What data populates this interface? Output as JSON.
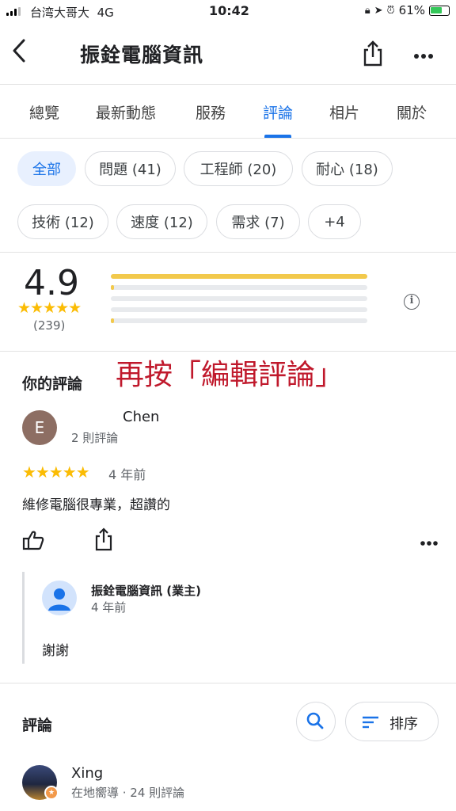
{
  "status_bar": {
    "carrier": "台湾大哥大",
    "network": "4G",
    "time": "10:42",
    "battery": "61%",
    "battery_level": 0.61
  },
  "header": {
    "title": "振銓電腦資訊"
  },
  "tabs": [
    {
      "label": "總覽",
      "active": false
    },
    {
      "label": "最新動態",
      "active": false
    },
    {
      "label": "服務",
      "active": false
    },
    {
      "label": "評論",
      "active": true
    },
    {
      "label": "相片",
      "active": false
    },
    {
      "label": "關於",
      "active": false
    }
  ],
  "filters": [
    {
      "label": "全部",
      "selected": true
    },
    {
      "label": "問題 (41)",
      "selected": false
    },
    {
      "label": "工程師 (20)",
      "selected": false
    },
    {
      "label": "耐心 (18)",
      "selected": false
    },
    {
      "label": "技術 (12)",
      "selected": false
    },
    {
      "label": "速度 (12)",
      "selected": false
    },
    {
      "label": "需求 (7)",
      "selected": false
    },
    {
      "label": "+4",
      "selected": false
    }
  ],
  "rating": {
    "average": "4.9",
    "stars": "★★★★★",
    "count": "(239)",
    "distribution": [
      1.0,
      0.01,
      0.0,
      0.0,
      0.01
    ]
  },
  "annotation": "再按「編輯評論」",
  "your_review": {
    "section_title": "你的評論",
    "avatar_letter": "E",
    "author": "Chen",
    "author_meta": "2 則評論",
    "stars": "★★★★★",
    "date": "4 年前",
    "text": "維修電腦很專業，超讚的"
  },
  "owner_reply": {
    "name": "振銓電腦資訊 (業主)",
    "date": "4 年前",
    "text": "謝謝"
  },
  "reviews": {
    "section_title": "評論",
    "sort_label": "排序",
    "first": {
      "author": "Xing",
      "meta": "在地嚮導 · 24 則評論"
    }
  },
  "colors": {
    "accent": "#1a73e8",
    "star": "#fbbc04",
    "annotation": "#c0192c"
  }
}
